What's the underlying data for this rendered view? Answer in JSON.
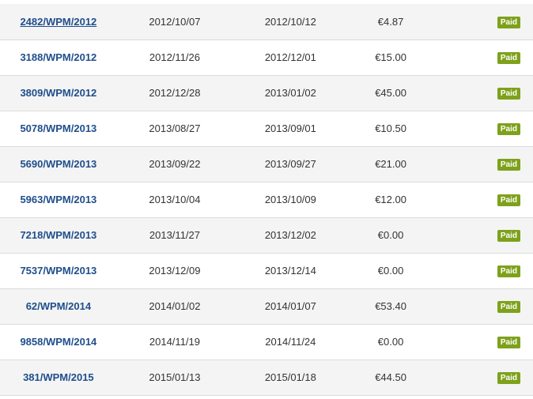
{
  "invoices": [
    {
      "number": "2482/WPM/2012",
      "date": "2012/10/07",
      "due": "2012/10/12",
      "amount": "€4.87",
      "status": "Paid"
    },
    {
      "number": "3188/WPM/2012",
      "date": "2012/11/26",
      "due": "2012/12/01",
      "amount": "€15.00",
      "status": "Paid"
    },
    {
      "number": "3809/WPM/2012",
      "date": "2012/12/28",
      "due": "2013/01/02",
      "amount": "€45.00",
      "status": "Paid"
    },
    {
      "number": "5078/WPM/2013",
      "date": "2013/08/27",
      "due": "2013/09/01",
      "amount": "€10.50",
      "status": "Paid"
    },
    {
      "number": "5690/WPM/2013",
      "date": "2013/09/22",
      "due": "2013/09/27",
      "amount": "€21.00",
      "status": "Paid"
    },
    {
      "number": "5963/WPM/2013",
      "date": "2013/10/04",
      "due": "2013/10/09",
      "amount": "€12.00",
      "status": "Paid"
    },
    {
      "number": "7218/WPM/2013",
      "date": "2013/11/27",
      "due": "2013/12/02",
      "amount": "€0.00",
      "status": "Paid"
    },
    {
      "number": "7537/WPM/2013",
      "date": "2013/12/09",
      "due": "2013/12/14",
      "amount": "€0.00",
      "status": "Paid"
    },
    {
      "number": "62/WPM/2014",
      "date": "2014/01/02",
      "due": "2014/01/07",
      "amount": "€53.40",
      "status": "Paid"
    },
    {
      "number": "9858/WPM/2014",
      "date": "2014/11/19",
      "due": "2014/11/24",
      "amount": "€0.00",
      "status": "Paid"
    },
    {
      "number": "381/WPM/2015",
      "date": "2015/01/13",
      "due": "2015/01/18",
      "amount": "€44.50",
      "status": "Paid"
    }
  ],
  "colors": {
    "link": "#1f4e8c",
    "badge": "#7ea11b",
    "row_alt": "#f4f4f4"
  }
}
